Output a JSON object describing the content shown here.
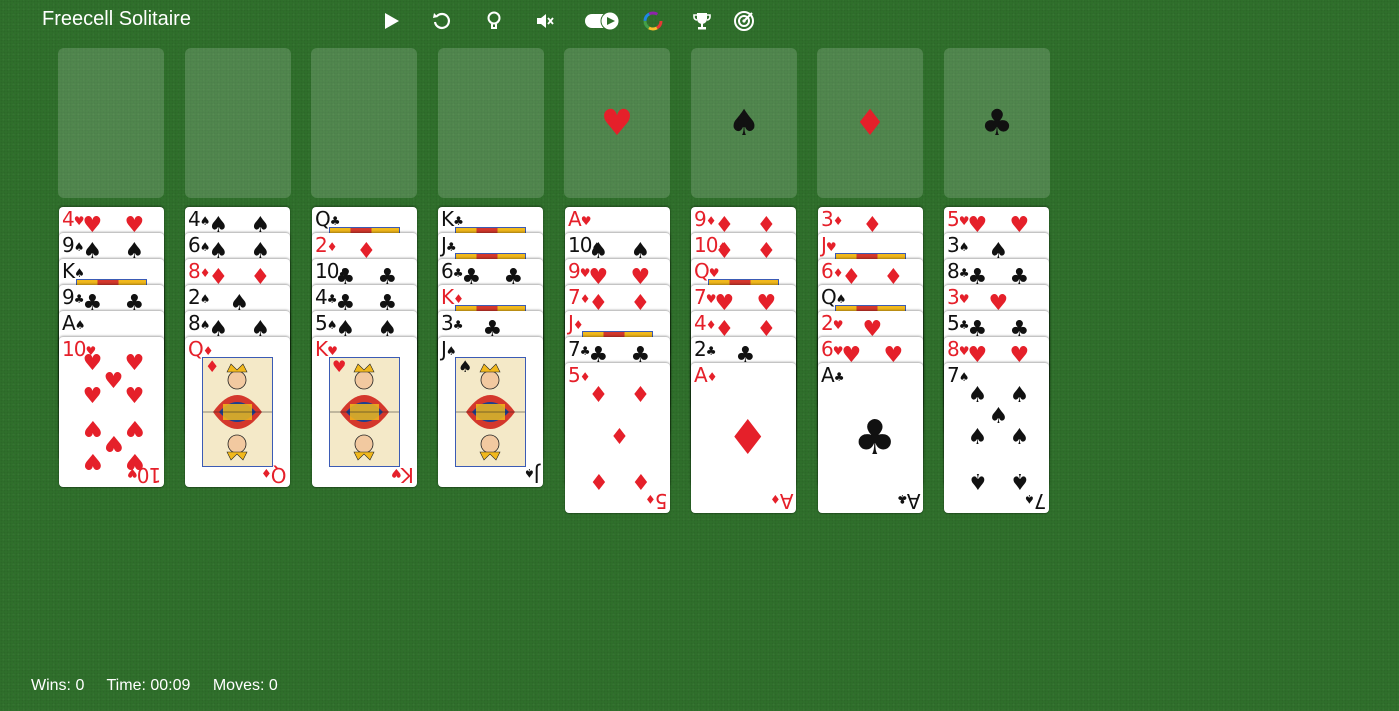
{
  "app": {
    "title": "Freecell Solitaire"
  },
  "toolbar": [
    {
      "name": "play-icon"
    },
    {
      "name": "undo-icon"
    },
    {
      "name": "hint-lightbulb-icon"
    },
    {
      "name": "mute-icon"
    },
    {
      "name": "autoplay-toggle-icon"
    },
    {
      "name": "color-theme-icon"
    },
    {
      "name": "trophy-icon"
    },
    {
      "name": "target-icon"
    }
  ],
  "foundations": [
    {
      "suit": "♥",
      "color": "#e5202a"
    },
    {
      "suit": "♠",
      "color": "#111111"
    },
    {
      "suit": "♦",
      "color": "#e5202a"
    },
    {
      "suit": "♣",
      "color": "#111111"
    }
  ],
  "columns": [
    [
      "4♥",
      "9♠",
      "K♠",
      "9♣",
      "A♠",
      "10♥"
    ],
    [
      "4♠",
      "6♠",
      "8♦",
      "2♠",
      "8♠",
      "Q♦"
    ],
    [
      "Q♣",
      "2♦",
      "10♣",
      "4♣",
      "5♠",
      "K♥"
    ],
    [
      "K♣",
      "J♣",
      "6♣",
      "K♦",
      "3♣",
      "J♠"
    ],
    [
      "A♥",
      "10♠",
      "9♥",
      "7♦",
      "J♦",
      "7♣",
      "5♦"
    ],
    [
      "9♦",
      "10♦",
      "Q♥",
      "7♥",
      "4♦",
      "2♣",
      "A♦"
    ],
    [
      "3♦",
      "J♥",
      "6♦",
      "Q♠",
      "2♥",
      "6♥",
      "A♣"
    ],
    [
      "5♥",
      "3♠",
      "8♣",
      "3♥",
      "5♣",
      "8♥",
      "7♠"
    ]
  ],
  "stats": {
    "wins": "Wins: 0",
    "time": "Time: 00:09",
    "moves": "Moves: 0"
  },
  "colors": {
    "table": "#2f6f2b",
    "red": "#e5202a",
    "black": "#111111"
  }
}
